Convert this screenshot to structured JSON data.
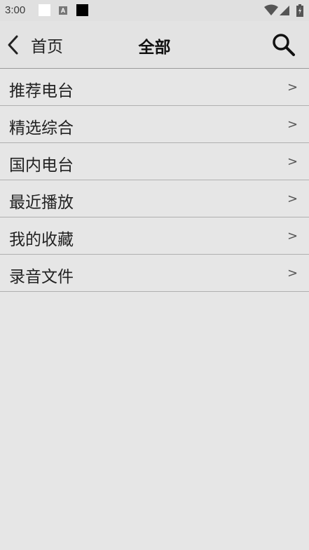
{
  "status_bar": {
    "time": "3:00",
    "notification_letter": "A",
    "icons": [
      "white-square-icon",
      "a-notification-icon",
      "black-square-icon",
      "wifi-icon",
      "signal-icon",
      "battery-icon"
    ]
  },
  "header": {
    "back_label": "首页",
    "title": "全部",
    "back_icon": "chevron-left-icon",
    "search_icon": "search-icon"
  },
  "menu": {
    "arrow_glyph": ">",
    "items": [
      {
        "label": "推荐电台"
      },
      {
        "label": "精选综合"
      },
      {
        "label": "国内电台"
      },
      {
        "label": "最近播放"
      },
      {
        "label": "我的收藏"
      },
      {
        "label": "录音文件"
      }
    ]
  },
  "colors": {
    "background": "#e6e6e6",
    "header_background": "#e3e3e3",
    "divider": "#b0b0b0",
    "text": "#222222"
  }
}
